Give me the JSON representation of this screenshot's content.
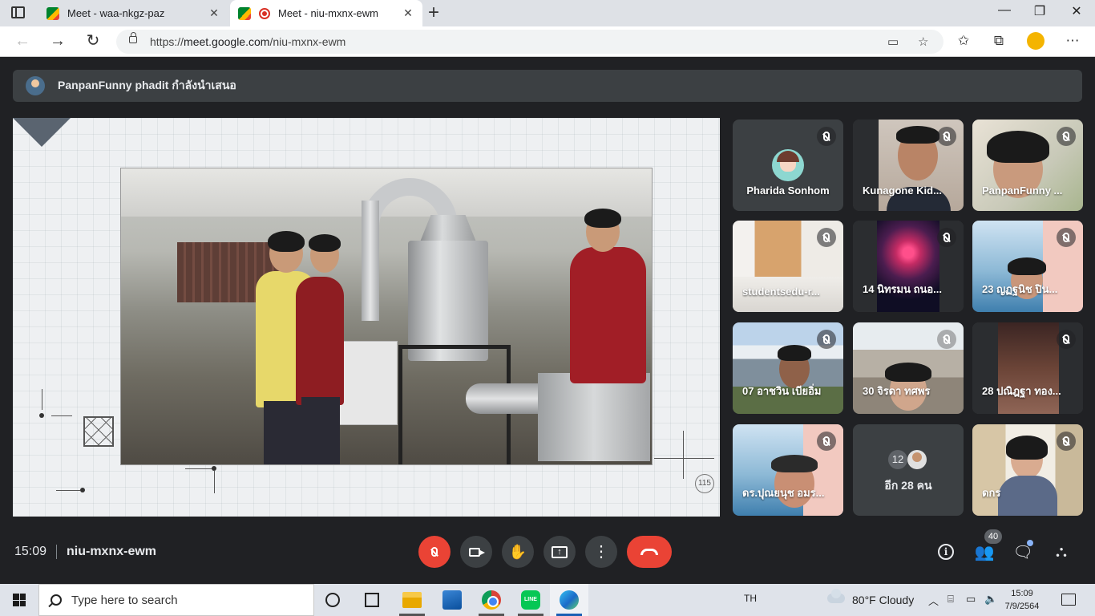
{
  "browser": {
    "tabs": [
      {
        "label": "Meet - waa-nkgz-paz",
        "active": false
      },
      {
        "label": "Meet - niu-mxnx-ewm",
        "active": true
      }
    ],
    "url_prefix": "https://",
    "url_host": "meet.google.com",
    "url_path": "/niu-mxnx-ewm",
    "window_controls": {
      "minimize": "—",
      "restore": "❐",
      "close": "✕"
    }
  },
  "meet": {
    "presenter_banner": "PanpanFunny phadit กำลังนำเสนอ",
    "slide_number": "115",
    "participants": [
      {
        "name": "Pharida Sonhom",
        "muted": true
      },
      {
        "name": "Kunagone Kid...",
        "muted": true
      },
      {
        "name": "PanpanFunny ...",
        "muted": true
      },
      {
        "name": "studentsedu-r...",
        "muted": true
      },
      {
        "name": "14 นิทรมน ถนอ...",
        "muted": true
      },
      {
        "name": "23 ญฏฐนิช ปิน...",
        "muted": true
      },
      {
        "name": "07 อาชวิน เบียอิ่ม",
        "muted": true
      },
      {
        "name": "30 จิรดา ทศพร",
        "muted": true
      },
      {
        "name": "28 ปณิฎฐา ทอง...",
        "muted": true
      },
      {
        "name": "ดร.ปุณยนุช อมร...",
        "muted": true
      },
      {
        "name": "ดกร",
        "muted": true
      }
    ],
    "others": {
      "count": "12",
      "label": "อีก 28 คน"
    },
    "bottom": {
      "time": "15:09",
      "meeting_code": "niu-mxnx-ewm",
      "people_count": "40"
    }
  },
  "taskbar": {
    "search_placeholder": "Type here to search",
    "language": "TH",
    "weather": "80°F  Cloudy",
    "time": "15:09",
    "date": "7/9/2564"
  },
  "colors": {
    "meet_bg": "#202124",
    "tile_bg": "#3c4043",
    "end_call_red": "#ea4335",
    "accent_blue": "#8ab4f8"
  }
}
